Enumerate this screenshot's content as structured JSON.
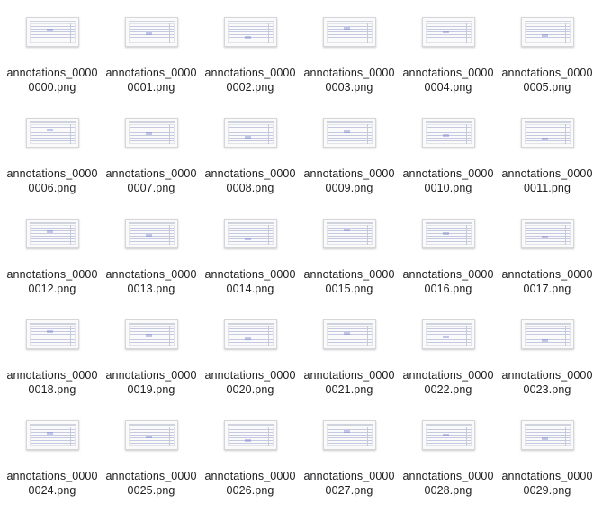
{
  "files": [
    {
      "line1": "annotations_0000",
      "line2": "0000.png"
    },
    {
      "line1": "annotations_0000",
      "line2": "0001.png"
    },
    {
      "line1": "annotations_0000",
      "line2": "0002.png"
    },
    {
      "line1": "annotations_0000",
      "line2": "0003.png"
    },
    {
      "line1": "annotations_0000",
      "line2": "0004.png"
    },
    {
      "line1": "annotations_0000",
      "line2": "0005.png"
    },
    {
      "line1": "annotations_0000",
      "line2": "0006.png"
    },
    {
      "line1": "annotations_0000",
      "line2": "0007.png"
    },
    {
      "line1": "annotations_0000",
      "line2": "0008.png"
    },
    {
      "line1": "annotations_0000",
      "line2": "0009.png"
    },
    {
      "line1": "annotations_0000",
      "line2": "0010.png"
    },
    {
      "line1": "annotations_0000",
      "line2": "0011.png"
    },
    {
      "line1": "annotations_0000",
      "line2": "0012.png"
    },
    {
      "line1": "annotations_0000",
      "line2": "0013.png"
    },
    {
      "line1": "annotations_0000",
      "line2": "0014.png"
    },
    {
      "line1": "annotations_0000",
      "line2": "0015.png"
    },
    {
      "line1": "annotations_0000",
      "line2": "0016.png"
    },
    {
      "line1": "annotations_0000",
      "line2": "0017.png"
    },
    {
      "line1": "annotations_0000",
      "line2": "0018.png"
    },
    {
      "line1": "annotations_0000",
      "line2": "0019.png"
    },
    {
      "line1": "annotations_0000",
      "line2": "0020.png"
    },
    {
      "line1": "annotations_0000",
      "line2": "0021.png"
    },
    {
      "line1": "annotations_0000",
      "line2": "0022.png"
    },
    {
      "line1": "annotations_0000",
      "line2": "0023.png"
    },
    {
      "line1": "annotations_0000",
      "line2": "0024.png"
    },
    {
      "line1": "annotations_0000",
      "line2": "0025.png"
    },
    {
      "line1": "annotations_0000",
      "line2": "0026.png"
    },
    {
      "line1": "annotations_0000",
      "line2": "0027.png"
    },
    {
      "line1": "annotations_0000",
      "line2": "0028.png"
    },
    {
      "line1": "annotations_0000",
      "line2": "0029.png"
    }
  ]
}
